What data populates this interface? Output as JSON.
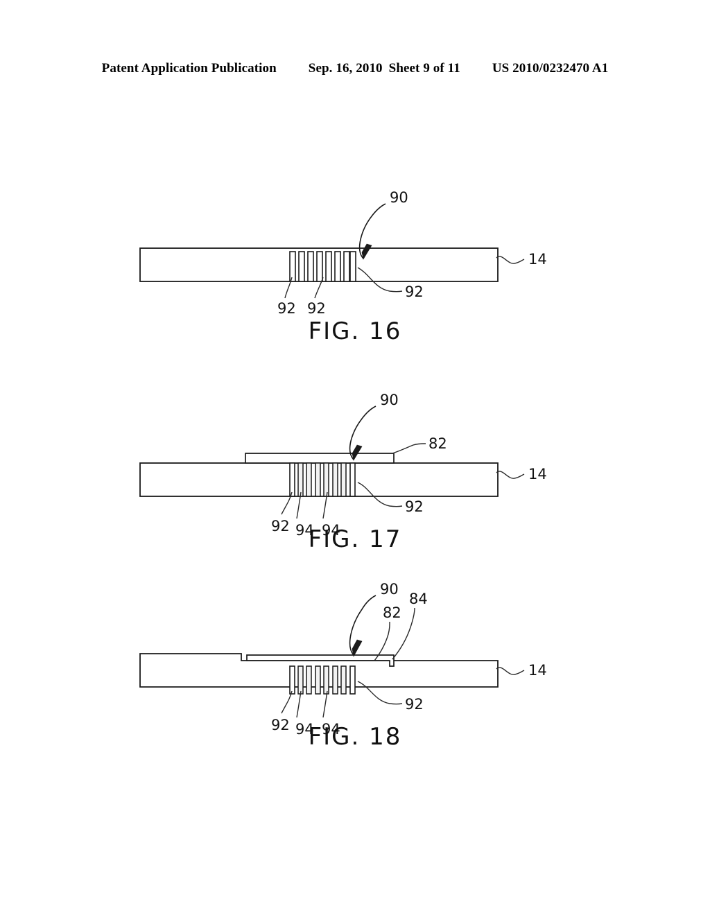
{
  "header": {
    "publication": "Patent Application Publication",
    "date": "Sep. 16, 2010",
    "sheet": "Sheet 9 of 11",
    "document_number": "US 2010/0232470 A1"
  },
  "figures": [
    {
      "id": "fig-16",
      "caption": "FIG. 16",
      "numerals": {
        "assembly": "90",
        "substrate": "14",
        "groove_left": "92",
        "groove_mid": "92",
        "groove_right": "92"
      }
    },
    {
      "id": "fig-17",
      "caption": "FIG. 17",
      "numerals": {
        "assembly": "90",
        "substrate": "14",
        "layer": "82",
        "groove_left": "92",
        "fill_left": "94",
        "fill_mid": "94",
        "groove_right": "92"
      }
    },
    {
      "id": "fig-18",
      "caption": "FIG. 18",
      "numerals": {
        "assembly": "90",
        "substrate": "14",
        "layer": "82",
        "layer_edge": "84",
        "groove_left": "92",
        "fill_left": "94",
        "fill_mid": "94",
        "groove_right": "92"
      }
    }
  ],
  "colors": {
    "ink": "#1a1a1a",
    "paper": "#ffffff",
    "fill_shade": "#f2f2f2"
  }
}
